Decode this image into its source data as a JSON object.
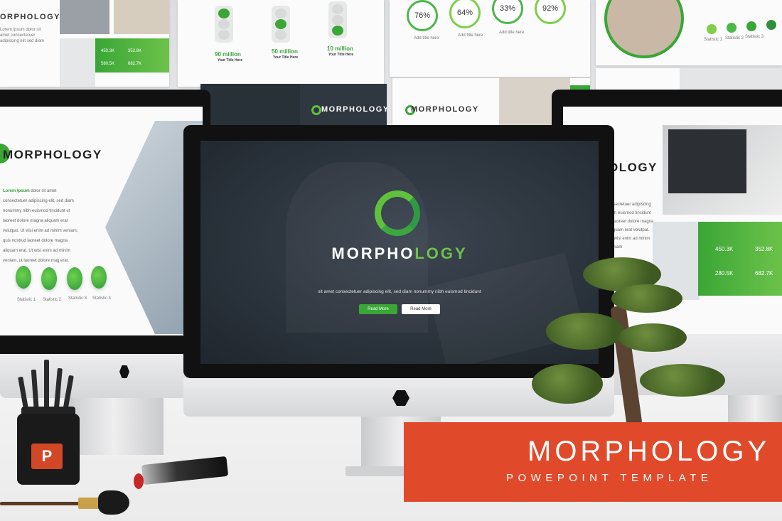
{
  "top_slides": {
    "left_brand": "ORPHOLOGY",
    "stats_small": [
      "450.3K",
      "352.8K",
      "580.5K",
      "682.7K"
    ],
    "traffic": [
      {
        "value": "90 million",
        "caption": "Your Title Here"
      },
      {
        "value": "50 million",
        "caption": "Your Title Here"
      },
      {
        "value": "10 million",
        "caption": "Your Title Here"
      }
    ],
    "gauges": [
      "76%",
      "64%",
      "33%",
      "92%"
    ],
    "gauge_caption": "Add title here",
    "statistic_labels": [
      "Statistic 1",
      "Statistic 2",
      "Statistic 3",
      "Statistic 4"
    ],
    "mid_brand_1": "MORPHOLOGY",
    "mid_brand_2": "MORPHOLOGY"
  },
  "left_screen": {
    "brand": "MORPHOLOGY",
    "lead": "Lorem Ipsum",
    "body": "dolor sit amet consectetuer adipiscing elit, sed diam nonummy nibh euismod tincidunt ut laoreet dolore magna aliquam erat volutpat. Ut wisi enim ad minim veniam, quis nostrud laoreet dolore magna aliquam erat. Ut wisi enim ad minim veniam, ut laoreet dolore mag erat.",
    "stats": [
      "Statistic 1",
      "Statistic 2",
      "Statistic 3",
      "Statistic 4"
    ]
  },
  "center_screen": {
    "title_main": "MORPHO",
    "title_accent": "LOGY",
    "tagline": "sit amet consectetuer adipiscing elit, sed diam nonummy nibh euismod tincidunt",
    "btn_primary": "Read More",
    "btn_secondary": "Read More"
  },
  "right_screen": {
    "brand": "OLOGY",
    "body": "onsectetuer adipiscing nibh euismod tincidunt ut laoreet dolore magna aliquam erat volutpat. Ut wisi enim ad minim veniam",
    "stats": [
      "450.3K",
      "352.8K",
      "280.5K",
      "682.7K"
    ]
  },
  "banner": {
    "title": "MORPHOLOGY",
    "subtitle": "POWEPOINT TEMPLATE"
  },
  "ppt_icon_letter": "P",
  "colors": {
    "accent_green": "#3aa636",
    "light_green": "#6cc24a",
    "banner_red": "#e04a2b",
    "dark_slide": "#283038"
  }
}
